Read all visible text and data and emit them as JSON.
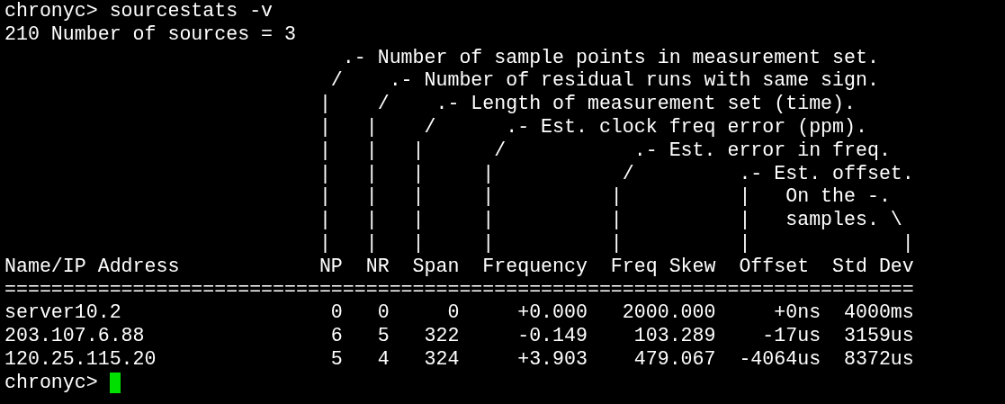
{
  "terminal": {
    "lines": [
      {
        "kind": "command",
        "text": "chronyc> sourcestats -v"
      },
      {
        "kind": "output",
        "text": "210 Number of sources = 3"
      },
      {
        "kind": "legend",
        "text": "                             .- Number of sample points in measurement set."
      },
      {
        "kind": "legend",
        "text": "                            /    .- Number of residual runs with same sign."
      },
      {
        "kind": "legend",
        "text": "                           |    /    .- Length of measurement set (time)."
      },
      {
        "kind": "legend",
        "text": "                           |   |    /      .- Est. clock freq error (ppm)."
      },
      {
        "kind": "legend",
        "text": "                           |   |   |      /           .- Est. error in freq."
      },
      {
        "kind": "legend",
        "text": "                           |   |   |     |           /         .- Est. offset."
      },
      {
        "kind": "legend",
        "text": "                           |   |   |     |          |          |   On the -."
      },
      {
        "kind": "legend",
        "text": "                           |   |   |     |          |          |   samples. \\"
      },
      {
        "kind": "legend",
        "text": "                           |   |   |     |          |          |             |"
      },
      {
        "kind": "header",
        "text": "Name/IP Address            NP  NR  Span  Frequency  Freq Skew  Offset  Std Dev"
      },
      {
        "kind": "rule",
        "text": "=============================================================================="
      },
      {
        "kind": "row",
        "text": "server10.2                  0   0     0     +0.000   2000.000     +0ns  4000ms"
      },
      {
        "kind": "row",
        "text": "203.107.6.88                6   5   322     -0.149    103.289    -17us  3159us"
      },
      {
        "kind": "row",
        "text": "120.25.115.20               5   4   324     +3.903    479.067  -4064us  8372us"
      },
      {
        "kind": "prompt",
        "text": "chronyc>",
        "cursor": true
      }
    ]
  }
}
